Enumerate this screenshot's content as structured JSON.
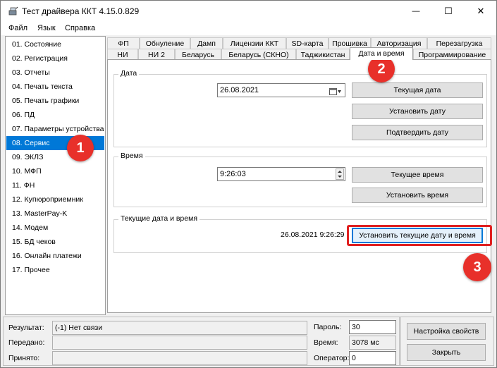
{
  "window": {
    "title": "Тест драйвера ККТ 4.15.0.829",
    "controls": {
      "minimize": "—",
      "maximize": "☐",
      "close": "✕"
    }
  },
  "menu": [
    "Файл",
    "Язык",
    "Справка"
  ],
  "sidebar": {
    "items": [
      "01. Состояние",
      "02. Регистрация",
      "03. Отчеты",
      "04. Печать текста",
      "05. Печать графики",
      "06. ПД",
      "07. Параметры устройства",
      "08. Сервис",
      "09. ЭКЛЗ",
      "10. МФП",
      "11. ФН",
      "12. Купюроприемник",
      "13. MasterPay-K",
      "14. Модем",
      "15. БД чеков",
      "16. Онлайн платежи",
      "17. Прочее"
    ],
    "selected_index": 7
  },
  "tabs": {
    "row1": [
      "ФП",
      "Обнуление",
      "Дамп",
      "Лицензии ККТ",
      "SD-карта",
      "Прошивка",
      "Авторизация",
      "Перезагрузка"
    ],
    "row2": [
      "НИ",
      "НИ 2",
      "Беларусь",
      "Беларусь (СКНО)",
      "Таджикистан",
      "Дата и время",
      "Программирование"
    ],
    "active": "Дата и время"
  },
  "date_group": {
    "label": "Дата",
    "value": "26.08.2021",
    "buttons": [
      "Текущая дата",
      "Установить дату",
      "Подтвердить дату"
    ]
  },
  "time_group": {
    "label": "Время",
    "value": "9:26:03",
    "buttons": [
      "Текущее время",
      "Установить время"
    ]
  },
  "current_group": {
    "label": "Текущие дата и время",
    "value": "26.08.2021  9:26:29",
    "button": "Установить текущие дату и время"
  },
  "badges": [
    "1",
    "2",
    "3"
  ],
  "status": {
    "result_label": "Результат:",
    "result_value": "(-1) Нет связи",
    "sent_label": "Передано:",
    "sent_value": "",
    "received_label": "Принято:",
    "received_value": "",
    "password_label": "Пароль:",
    "password_value": "30",
    "time_label": "Время:",
    "time_value": "3078 мс",
    "operator_label": "Оператор:",
    "operator_value": "0"
  },
  "bottom_buttons": {
    "settings": "Настройка свойств",
    "close": "Закрыть"
  },
  "colors": {
    "accent": "#0078d7",
    "badge": "#e8302a",
    "highlight_border": "#e02020"
  }
}
